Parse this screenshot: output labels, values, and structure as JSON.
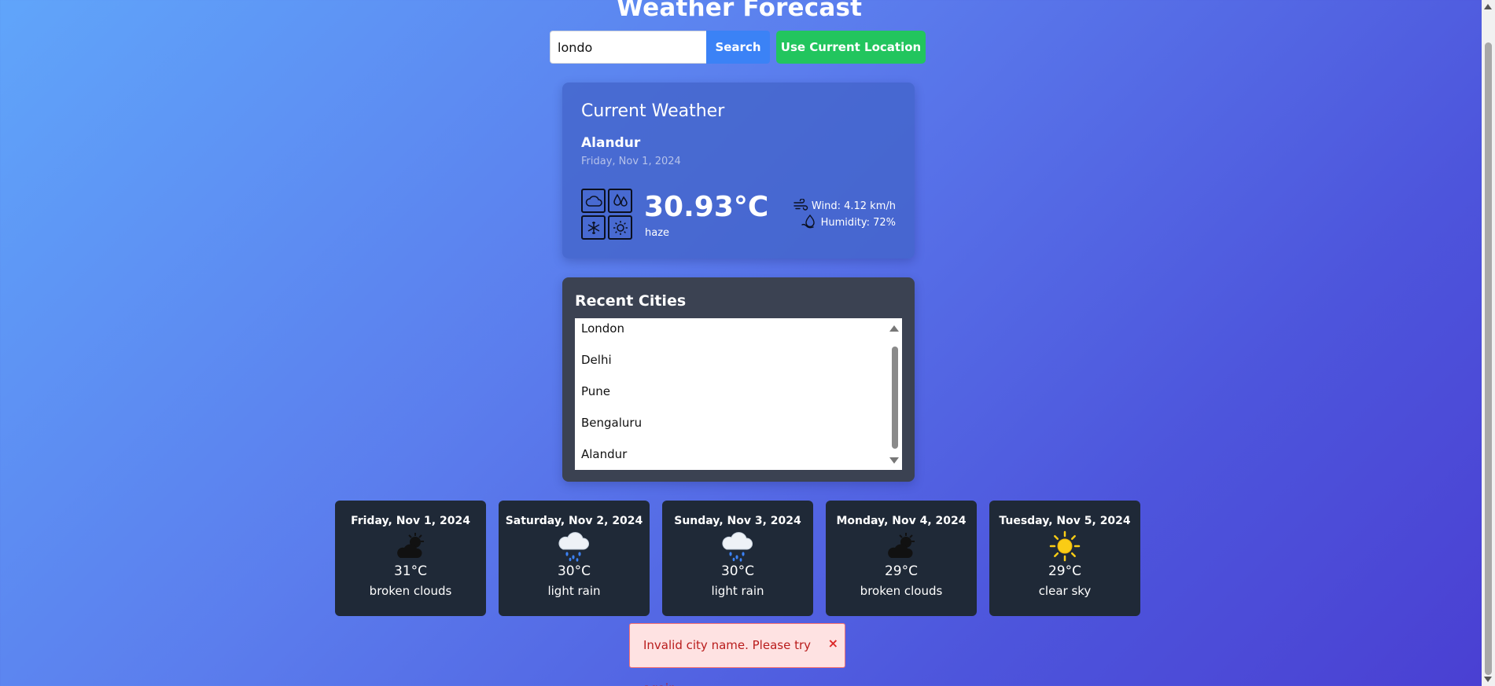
{
  "header": {
    "title": "Weather Forecast"
  },
  "search": {
    "value": "londo",
    "button_label": "Search",
    "location_button_label": "Use Current Location"
  },
  "current": {
    "heading": "Current Weather",
    "city": "Alandur",
    "date": "Friday, Nov 1, 2024",
    "temperature": "30.93°C",
    "condition": "haze",
    "wind": "Wind: 4.12 km/h",
    "humidity": "Humidity: 72%",
    "icons": [
      "cloud-icon",
      "droplets-icon",
      "snowflake-icon",
      "sun-icon"
    ]
  },
  "recent": {
    "heading": "Recent Cities",
    "cities": [
      "London",
      "Delhi",
      "Pune",
      "Bengaluru",
      "Alandur"
    ]
  },
  "forecast": [
    {
      "date": "Friday, Nov 1, 2024",
      "icon": "sun-behind-cloud-icon",
      "temp": "31°C",
      "desc": "broken clouds"
    },
    {
      "date": "Saturday, Nov 2, 2024",
      "icon": "rain-cloud-icon",
      "temp": "30°C",
      "desc": "light rain"
    },
    {
      "date": "Sunday, Nov 3, 2024",
      "icon": "rain-cloud-icon",
      "temp": "30°C",
      "desc": "light rain"
    },
    {
      "date": "Monday, Nov 4, 2024",
      "icon": "sun-behind-cloud-icon",
      "temp": "29°C",
      "desc": "broken clouds"
    },
    {
      "date": "Tuesday, Nov 5, 2024",
      "icon": "sun-icon",
      "temp": "29°C",
      "desc": "clear sky"
    }
  ],
  "error": {
    "message": "Invalid city name. Please try again.",
    "close": "×"
  },
  "colors": {
    "search_button": "#3b82f6",
    "location_button": "#22c55e",
    "forecast_card": "#1f2937",
    "error_bg": "#fee2e2",
    "error_text": "#b91c1c"
  }
}
